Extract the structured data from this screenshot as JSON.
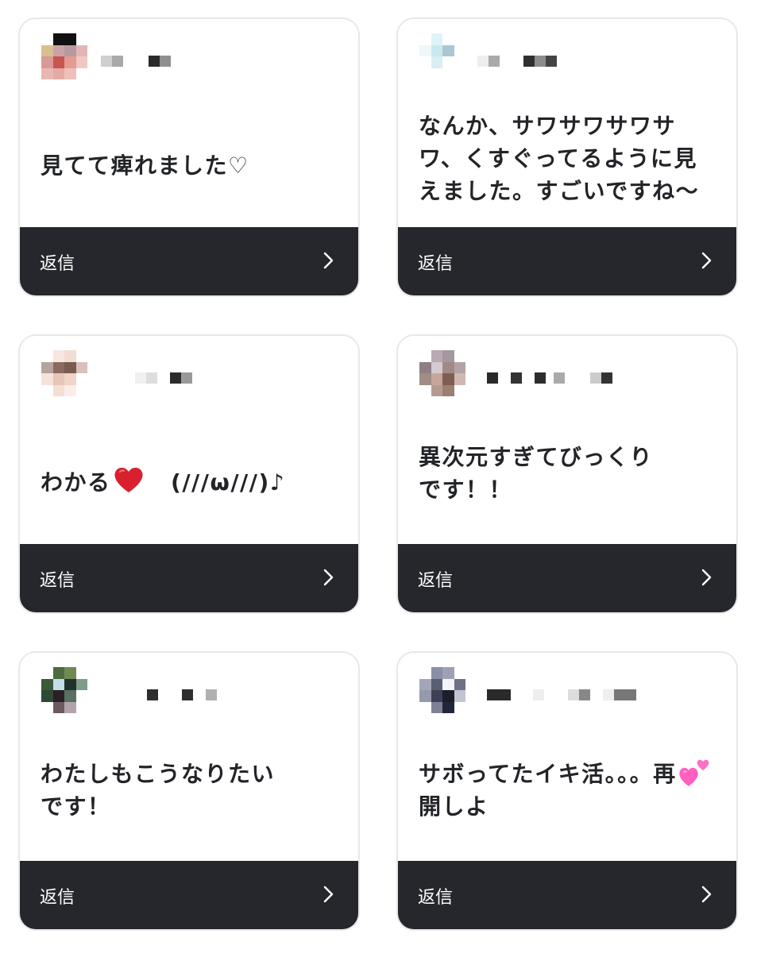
{
  "reply_label": "返信",
  "cards": [
    {
      "comment": "見てて痺れました♡"
    },
    {
      "comment": "なんか、サワサワサワサ\nワ、くすぐってるように見\nえました。すごいですね〜"
    },
    {
      "comment_before": "わかる",
      "comment_emoji": "red-heart",
      "comment_after": "　(///ω///)♪"
    },
    {
      "comment": "異次元すぎてびっくり\nです！！"
    },
    {
      "comment": "わたしもこうなりたい\nです！"
    },
    {
      "comment_before": "サボってたイキ活。。。再\n開しよ",
      "comment_emoji": "two-hearts"
    }
  ],
  "colors": {
    "reply_bar": "#25272c",
    "card_border": "#e7e8ea",
    "comment_text": "#222428"
  }
}
